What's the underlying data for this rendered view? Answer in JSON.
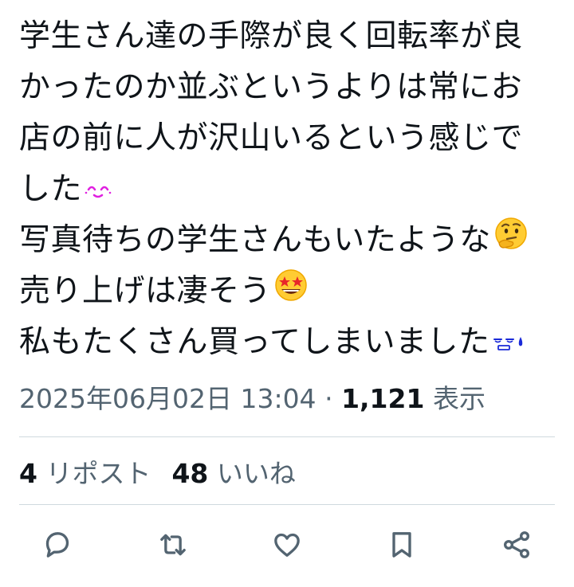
{
  "tweet": {
    "lines": [
      "学生さん達の手際が良く回転率が良",
      "かったのか並ぶというよりは常にお",
      "店の前に人が沢山いるという感じで",
      "した",
      "写真待ちの学生さんもいたような",
      "売り上げは凄そう",
      "私もたくさん買ってしまいました"
    ],
    "emojis": {
      "line4": "smiling-eyes-kaomoji",
      "line5": "thinking-face",
      "line6": "star-struck",
      "line7": "sweat-kaomoji"
    }
  },
  "meta": {
    "datetime": "2025年06月02日 13:04",
    "separator": "·",
    "views_count": "1,121",
    "views_label": "表示"
  },
  "stats": {
    "reposts_count": "4",
    "reposts_label": "リポスト",
    "likes_count": "48",
    "likes_label": "いいね"
  },
  "colors": {
    "text": "#0f1419",
    "secondary": "#536471",
    "divider": "#cfd9de",
    "kaomoji_pink": "#e020e0",
    "kaomoji_blue": "#1a2ad8"
  },
  "actions": [
    "reply-icon",
    "retweet-icon",
    "like-icon",
    "bookmark-icon",
    "share-icon"
  ]
}
